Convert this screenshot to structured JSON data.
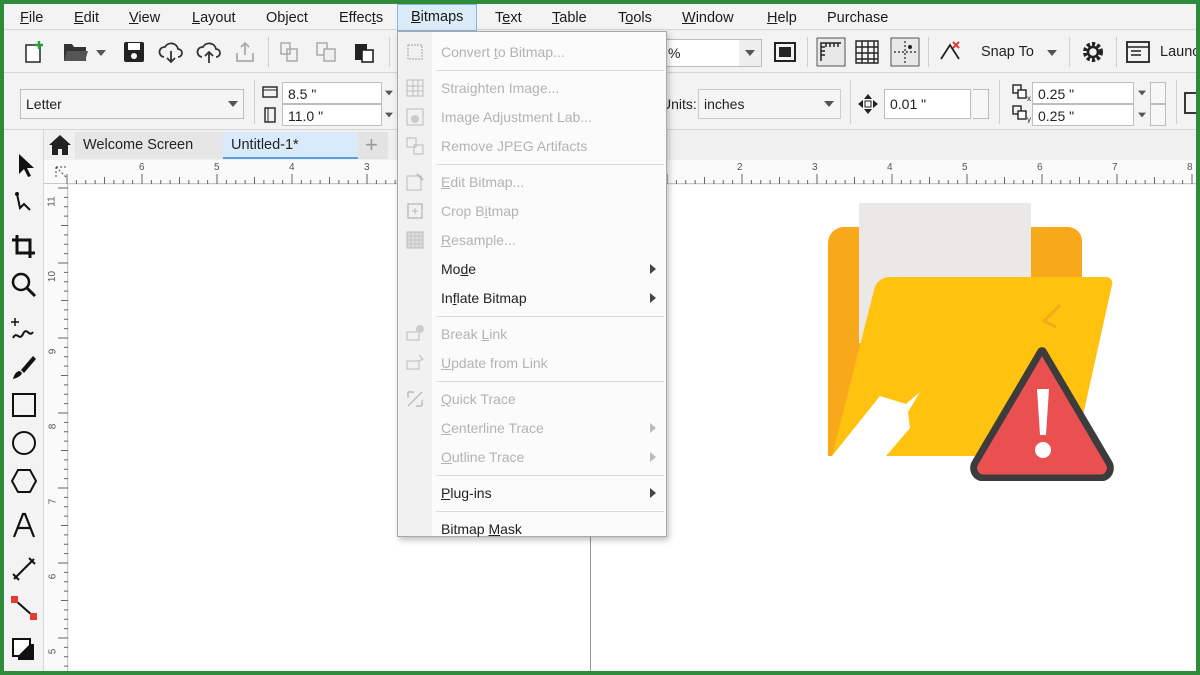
{
  "menubar": {
    "items": [
      {
        "label": "File",
        "ul": 0
      },
      {
        "label": "Edit",
        "ul": 0
      },
      {
        "label": "View",
        "ul": 0
      },
      {
        "label": "Layout",
        "ul": 0
      },
      {
        "label": "Object",
        "ul": -1
      },
      {
        "label": "Effects",
        "ul": 5
      },
      {
        "label": "Bitmaps",
        "ul": 0
      },
      {
        "label": "Text",
        "ul": 1
      },
      {
        "label": "Table",
        "ul": 0
      },
      {
        "label": "Tools",
        "ul": 1
      },
      {
        "label": "Window",
        "ul": 0
      },
      {
        "label": "Help",
        "ul": 0
      },
      {
        "label": "Purchase",
        "ul": -1
      }
    ],
    "active": "Bitmaps"
  },
  "standard_bar": {
    "zoom_value": "%",
    "snap_to_label": "Snap To",
    "launch_label": "Launc"
  },
  "property_bar": {
    "page_size": "Letter",
    "width": "8.5 \"",
    "height": "11.0 \"",
    "units_label": "Units:",
    "units_value": "inches",
    "nudge": "0.01 \"",
    "dup_x": "0.25 \"",
    "dup_y": "0.25 \"",
    "dup_x_sub": "x",
    "dup_y_sub": "y"
  },
  "tabs": {
    "welcome": "Welcome Screen",
    "document": "Untitled-1*",
    "add": "+"
  },
  "ruler": {
    "h_left": [
      "6",
      "5",
      "4",
      "3"
    ],
    "h_right": [
      "2",
      "3",
      "4",
      "5",
      "6",
      "7",
      "8"
    ],
    "v": [
      "11",
      "10",
      "9",
      "8",
      "7",
      "6",
      "5"
    ]
  },
  "bitmaps_menu": {
    "items": [
      {
        "label": "Convert to Bitmap...",
        "disabled": true,
        "icon": "convert-bitmap-icon",
        "ul": 8
      },
      {
        "sep": true
      },
      {
        "label": "Straighten Image...",
        "disabled": true,
        "icon": "straighten-image-icon",
        "ul": -1
      },
      {
        "label": "Image Adjustment Lab...",
        "disabled": true,
        "icon": "image-adjustment-icon",
        "ul": -1
      },
      {
        "label": "Remove JPEG Artifacts",
        "disabled": true,
        "icon": "remove-jpeg-icon",
        "ul": -1
      },
      {
        "sep": true
      },
      {
        "label": "Edit Bitmap...",
        "disabled": true,
        "icon": "edit-bitmap-icon",
        "ul": 0
      },
      {
        "label": "Crop Bitmap",
        "disabled": true,
        "icon": "crop-bitmap-icon",
        "ul": 6
      },
      {
        "label": "Resample...",
        "disabled": true,
        "icon": "resample-icon",
        "ul": 0
      },
      {
        "label": "Mode",
        "disabled": false,
        "icon": "",
        "ul": 2,
        "submenu": true
      },
      {
        "label": "Inflate Bitmap",
        "disabled": false,
        "icon": "",
        "ul": 2,
        "submenu": true
      },
      {
        "sep": true
      },
      {
        "label": "Break Link",
        "disabled": true,
        "icon": "break-link-icon",
        "ul": 6
      },
      {
        "label": "Update from Link",
        "disabled": true,
        "icon": "update-link-icon",
        "ul": 0
      },
      {
        "sep": true
      },
      {
        "label": "Quick Trace",
        "disabled": true,
        "icon": "quick-trace-icon",
        "ul": 0
      },
      {
        "label": "Centerline Trace",
        "disabled": true,
        "icon": "",
        "ul": 0,
        "submenu": true
      },
      {
        "label": "Outline Trace",
        "disabled": true,
        "icon": "",
        "ul": 0,
        "submenu": true
      },
      {
        "sep": true
      },
      {
        "label": "Plug-ins",
        "disabled": false,
        "icon": "",
        "ul": 0,
        "submenu": true
      },
      {
        "sep": true
      },
      {
        "label": "Bitmap Mask",
        "disabled": false,
        "icon": "",
        "ul": 7
      }
    ]
  },
  "colors": {
    "frame": "#2e8b3a",
    "folder_back": "#f7a81b",
    "folder_front": "#ffc20e",
    "paper": "#ebe9e8",
    "warning_red": "#e9504f",
    "warning_border": "#3c3c3c",
    "tab_active": "#d9ebfa"
  }
}
